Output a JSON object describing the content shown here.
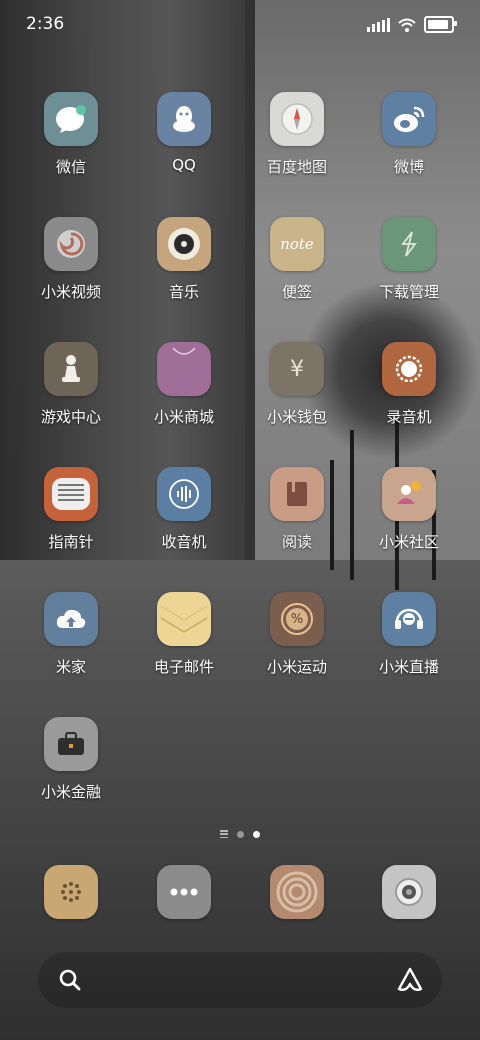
{
  "status": {
    "time": "2:36"
  },
  "apps": [
    {
      "label": "微信"
    },
    {
      "label": "QQ"
    },
    {
      "label": "百度地图"
    },
    {
      "label": "微博"
    },
    {
      "label": "小米视频"
    },
    {
      "label": "音乐"
    },
    {
      "label": "便签",
      "icon_text": "note"
    },
    {
      "label": "下载管理"
    },
    {
      "label": "游戏中心"
    },
    {
      "label": "小米商城"
    },
    {
      "label": "小米钱包",
      "icon_text": "¥"
    },
    {
      "label": "录音机"
    },
    {
      "label": "指南针"
    },
    {
      "label": "收音机"
    },
    {
      "label": "阅读"
    },
    {
      "label": "小米社区"
    },
    {
      "label": "米家"
    },
    {
      "label": "电子邮件"
    },
    {
      "label": "小米运动",
      "icon_text": "%"
    },
    {
      "label": "小米直播"
    },
    {
      "label": "小米金融"
    }
  ],
  "colors": {
    "wechat": "#6f8f96",
    "qq": "#6b83a3",
    "maps": "#d9d9d6",
    "weibo": "#5f7fa3",
    "video": "#8a8a8a",
    "music": "#c4a57e",
    "notes": "#c9b48a",
    "download": "#6c9679",
    "game": "#6e6457",
    "mall": "#9e6d98",
    "wallet": "#7c7466",
    "recorder": "#b0673f",
    "compass": "#c4623a",
    "radio": "#5d7ea3",
    "reader": "#c99c86",
    "community": "#c9a58d",
    "mijia": "#627f9e",
    "mail": "#ecd595",
    "sport": "#7c5e4f",
    "live": "#5e80a2",
    "finance": "#9a9a9a",
    "dock1": "#c8a773",
    "dock2": "#8c8c8c",
    "dock3": "#b38a70",
    "dock4": "#c4c4c4"
  },
  "dock": [
    {
      "name": "dock-app-1"
    },
    {
      "name": "dock-app-2"
    },
    {
      "name": "dock-app-3"
    },
    {
      "name": "dock-app-4"
    }
  ]
}
